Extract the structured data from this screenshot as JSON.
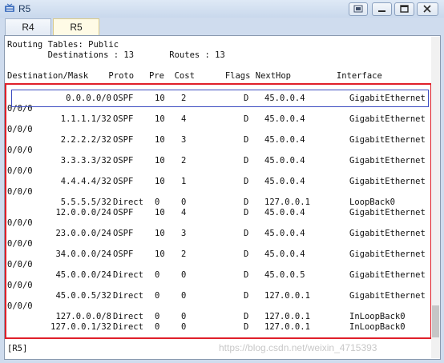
{
  "window": {
    "title": "R5",
    "controls": [
      "restore-icon",
      "minimize-icon",
      "maximize-icon",
      "close-icon"
    ]
  },
  "tabs": [
    {
      "label": "R4",
      "active": false
    },
    {
      "label": "R5",
      "active": true
    }
  ],
  "console": {
    "header1": "Routing Tables: Public",
    "header2": "        Destinations : 13       Routes : 13",
    "column_header": "Destination/Mask    Proto   Pre  Cost      Flags NextHop         Interface",
    "rows": [
      {
        "dest": "0.0.0.0/0",
        "proto": "OSPF",
        "pre": "10",
        "cost": "2",
        "flags": "D",
        "nexthop": "45.0.0.4",
        "iface": "GigabitEthernet",
        "cont": "0/0/0"
      },
      {
        "dest": "1.1.1.1/32",
        "proto": "OSPF",
        "pre": "10",
        "cost": "4",
        "flags": "D",
        "nexthop": "45.0.0.4",
        "iface": "GigabitEthernet",
        "cont": "0/0/0"
      },
      {
        "dest": "2.2.2.2/32",
        "proto": "OSPF",
        "pre": "10",
        "cost": "3",
        "flags": "D",
        "nexthop": "45.0.0.4",
        "iface": "GigabitEthernet",
        "cont": "0/0/0"
      },
      {
        "dest": "3.3.3.3/32",
        "proto": "OSPF",
        "pre": "10",
        "cost": "2",
        "flags": "D",
        "nexthop": "45.0.0.4",
        "iface": "GigabitEthernet",
        "cont": "0/0/0"
      },
      {
        "dest": "4.4.4.4/32",
        "proto": "OSPF",
        "pre": "10",
        "cost": "1",
        "flags": "D",
        "nexthop": "45.0.0.4",
        "iface": "GigabitEthernet",
        "cont": "0/0/0"
      },
      {
        "dest": "5.5.5.5/32",
        "proto": "Direct",
        "pre": "0",
        "cost": "0",
        "flags": "D",
        "nexthop": "127.0.0.1",
        "iface": "LoopBack0",
        "cont": ""
      },
      {
        "dest": "12.0.0.0/24",
        "proto": "OSPF",
        "pre": "10",
        "cost": "4",
        "flags": "D",
        "nexthop": "45.0.0.4",
        "iface": "GigabitEthernet",
        "cont": "0/0/0"
      },
      {
        "dest": "23.0.0.0/24",
        "proto": "OSPF",
        "pre": "10",
        "cost": "3",
        "flags": "D",
        "nexthop": "45.0.0.4",
        "iface": "GigabitEthernet",
        "cont": "0/0/0"
      },
      {
        "dest": "34.0.0.0/24",
        "proto": "OSPF",
        "pre": "10",
        "cost": "2",
        "flags": "D",
        "nexthop": "45.0.0.4",
        "iface": "GigabitEthernet",
        "cont": "0/0/0"
      },
      {
        "dest": "45.0.0.0/24",
        "proto": "Direct",
        "pre": "0",
        "cost": "0",
        "flags": "D",
        "nexthop": "45.0.0.5",
        "iface": "GigabitEthernet",
        "cont": "0/0/0"
      },
      {
        "dest": "45.0.0.5/32",
        "proto": "Direct",
        "pre": "0",
        "cost": "0",
        "flags": "D",
        "nexthop": "127.0.0.1",
        "iface": "GigabitEthernet",
        "cont": "0/0/0"
      },
      {
        "dest": "127.0.0.0/8",
        "proto": "Direct",
        "pre": "0",
        "cost": "0",
        "flags": "D",
        "nexthop": "127.0.0.1",
        "iface": "InLoopBack0",
        "cont": ""
      },
      {
        "dest": "127.0.0.1/32",
        "proto": "Direct",
        "pre": "0",
        "cost": "0",
        "flags": "D",
        "nexthop": "127.0.0.1",
        "iface": "InLoopBack0",
        "cont": ""
      }
    ],
    "prompt": "[R5]"
  },
  "watermark": "https://blog.csdn.net/weixin_4715393",
  "colors": {
    "highlight_red": "#e0202a",
    "highlight_blue": "#3b4cc0",
    "active_tab": "#fffbe6"
  }
}
